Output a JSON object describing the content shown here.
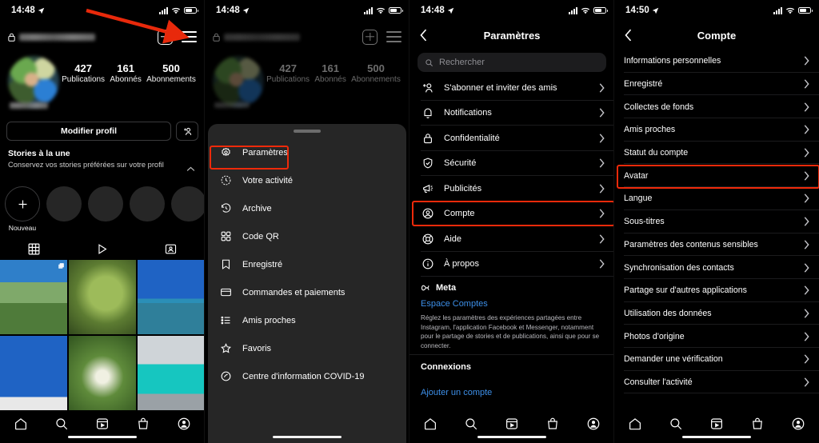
{
  "panel1": {
    "status": {
      "time": "14:48",
      "location_icon": "location-arrow-icon",
      "signal_icon": "cellular-bars-icon",
      "wifi_icon": "wifi-icon",
      "battery_icon": "battery-icon"
    },
    "header": {
      "lock_icon": "lock-icon",
      "username_redacted": "",
      "new_post_icon": "square-plus-icon",
      "menu_icon": "hamburger-menu-icon"
    },
    "stats": [
      {
        "number": "427",
        "label": "Publications"
      },
      {
        "number": "161",
        "label": "Abonnés"
      },
      {
        "number": "500",
        "label": "Abonnements"
      }
    ],
    "edit_profile_label": "Modifier profil",
    "add_person_icon": "add-person-icon",
    "stories": {
      "title": "Stories à la une",
      "subtitle": "Conservez vos stories préférées sur votre profil",
      "collapse_icon": "chevron-up-icon",
      "new_label": "Nouveau"
    },
    "profile_tabs": [
      "grid-icon",
      "reels-icon",
      "tagged-icon"
    ],
    "bottom_nav": [
      "home-icon",
      "search-icon",
      "reels-icon",
      "shop-icon",
      "profile-icon"
    ]
  },
  "panel2": {
    "status": {
      "time": "14:48"
    },
    "sheet_items": [
      {
        "icon": "gear-icon",
        "label": "Paramètres",
        "highlighted": true
      },
      {
        "icon": "clock-activity-icon",
        "label": "Votre activité",
        "highlighted": false
      },
      {
        "icon": "archive-clock-icon",
        "label": "Archive",
        "highlighted": false
      },
      {
        "icon": "qr-code-icon",
        "label": "Code QR",
        "highlighted": false
      },
      {
        "icon": "bookmark-icon",
        "label": "Enregistré",
        "highlighted": false
      },
      {
        "icon": "card-icon",
        "label": "Commandes et paiements",
        "highlighted": false
      },
      {
        "icon": "list-icon",
        "label": "Amis proches",
        "highlighted": false
      },
      {
        "icon": "star-icon",
        "label": "Favoris",
        "highlighted": false
      },
      {
        "icon": "covid-icon",
        "label": "Centre d'information COVID-19",
        "highlighted": false
      }
    ]
  },
  "panel3": {
    "status": {
      "time": "14:48"
    },
    "title": "Paramètres",
    "back_icon": "chevron-left-icon",
    "search": {
      "placeholder": "Rechercher",
      "icon": "search-icon"
    },
    "items": [
      {
        "icon": "add-person-icon",
        "label": "S'abonner et inviter des amis",
        "highlighted": false
      },
      {
        "icon": "bell-icon",
        "label": "Notifications",
        "highlighted": false
      },
      {
        "icon": "lock-icon",
        "label": "Confidentialité",
        "highlighted": false
      },
      {
        "icon": "shield-icon",
        "label": "Sécurité",
        "highlighted": false
      },
      {
        "icon": "megaphone-icon",
        "label": "Publicités",
        "highlighted": false
      },
      {
        "icon": "account-circle-icon",
        "label": "Compte",
        "highlighted": true
      },
      {
        "icon": "lifebuoy-icon",
        "label": "Aide",
        "highlighted": false
      },
      {
        "icon": "info-icon",
        "label": "À propos",
        "highlighted": false
      }
    ],
    "meta": {
      "brand": "Meta",
      "brand_icon": "meta-infinity-icon",
      "link": "Espace Comptes",
      "description": "Réglez les paramètres des expériences partagées entre Instagram, l'application Facebook et Messenger, notamment pour le partage de stories et de publications, ainsi que pour se connecter."
    },
    "connections_header": "Connexions",
    "add_account_link": "Ajouter un compte",
    "bottom_nav": [
      "home-icon",
      "search-icon",
      "reels-icon",
      "shop-icon",
      "profile-icon"
    ]
  },
  "panel4": {
    "status": {
      "time": "14:50"
    },
    "title": "Compte",
    "back_icon": "chevron-left-icon",
    "items": [
      {
        "label": "Informations personnelles",
        "highlighted": false
      },
      {
        "label": "Enregistré",
        "highlighted": false
      },
      {
        "label": "Collectes de fonds",
        "highlighted": false
      },
      {
        "label": "Amis proches",
        "highlighted": false
      },
      {
        "label": "Statut du compte",
        "highlighted": false
      },
      {
        "label": "Avatar",
        "highlighted": true
      },
      {
        "label": "Langue",
        "highlighted": false
      },
      {
        "label": "Sous-titres",
        "highlighted": false
      },
      {
        "label": "Paramètres des contenus sensibles",
        "highlighted": false
      },
      {
        "label": "Synchronisation des contacts",
        "highlighted": false
      },
      {
        "label": "Partage sur d'autres applications",
        "highlighted": false
      },
      {
        "label": "Utilisation des données",
        "highlighted": false
      },
      {
        "label": "Photos d'origine",
        "highlighted": false
      },
      {
        "label": "Demander une vérification",
        "highlighted": false
      },
      {
        "label": "Consulter l'activité",
        "highlighted": false
      }
    ],
    "bottom_nav": [
      "home-icon",
      "search-icon",
      "reels-icon",
      "shop-icon",
      "profile-icon"
    ]
  },
  "annotations": {
    "arrow_color": "#e8290b",
    "highlight_color": "#ef2a0a"
  }
}
